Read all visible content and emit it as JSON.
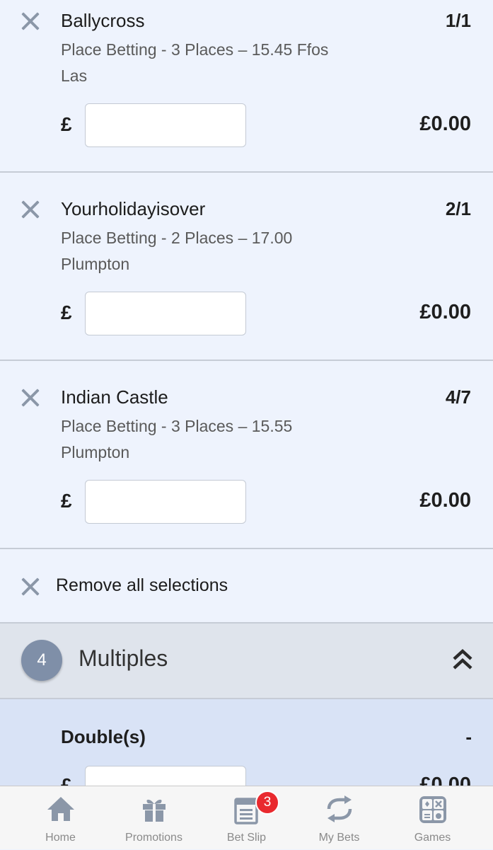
{
  "selections": [
    {
      "name": "Ballycross",
      "odds": "1/1",
      "market": "Place Betting - 3 Places – 15.45 Ffos Las",
      "currency": "£",
      "returns": "£0.00"
    },
    {
      "name": "Yourholidayisover",
      "odds": "2/1",
      "market": "Place Betting - 2 Places – 17.00 Plumpton",
      "currency": "£",
      "returns": "£0.00"
    },
    {
      "name": "Indian Castle",
      "odds": "4/7",
      "market": "Place Betting - 3 Places – 15.55 Plumpton",
      "currency": "£",
      "returns": "£0.00"
    }
  ],
  "remove_all": {
    "label": "Remove all selections"
  },
  "multiples": {
    "count": "4",
    "title": "Multiples"
  },
  "double": {
    "title": "Double(s)",
    "odds": "-",
    "currency": "£",
    "returns": "£0.00"
  },
  "nav": {
    "items": [
      {
        "label": "Home",
        "icon": "home-icon"
      },
      {
        "label": "Promotions",
        "icon": "gift-icon"
      },
      {
        "label": "Bet Slip",
        "icon": "betslip-icon",
        "badge": "3"
      },
      {
        "label": "My Bets",
        "icon": "refresh-arrows-icon"
      },
      {
        "label": "Games",
        "icon": "games-icon"
      }
    ]
  },
  "colors": {
    "badge": "#e9292e",
    "icon_gray": "#8b97a8",
    "selection_bg": "#eef3fd",
    "multiples_bg": "#dfe4ec",
    "double_bg": "#d9e3f6"
  }
}
